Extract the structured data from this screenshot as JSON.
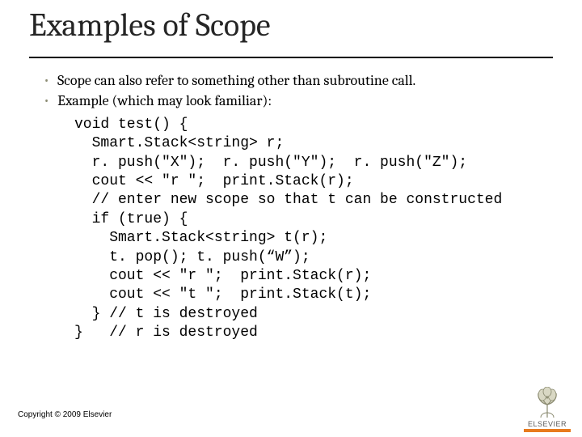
{
  "title": "Examples of Scope",
  "bullets": [
    "Scope can also refer to something other than subroutine call.",
    "Example (which may look familiar):"
  ],
  "code": "void test() {\n  Smart.Stack<string> r;\n  r. push(\"X\");  r. push(\"Y\");  r. push(\"Z\");\n  cout << \"r \";  print.Stack(r);\n  // enter new scope so that t can be constructed\n  if (true) {\n    Smart.Stack<string> t(r);\n    t. pop(); t. push(“W”);\n    cout << \"r \";  print.Stack(r);\n    cout << \"t \";  print.Stack(t);\n  } // t is destroyed\n}   // r is destroyed",
  "copyright": "Copyright © 2009 Elsevier",
  "logo": {
    "text": "ELSEVIER"
  }
}
